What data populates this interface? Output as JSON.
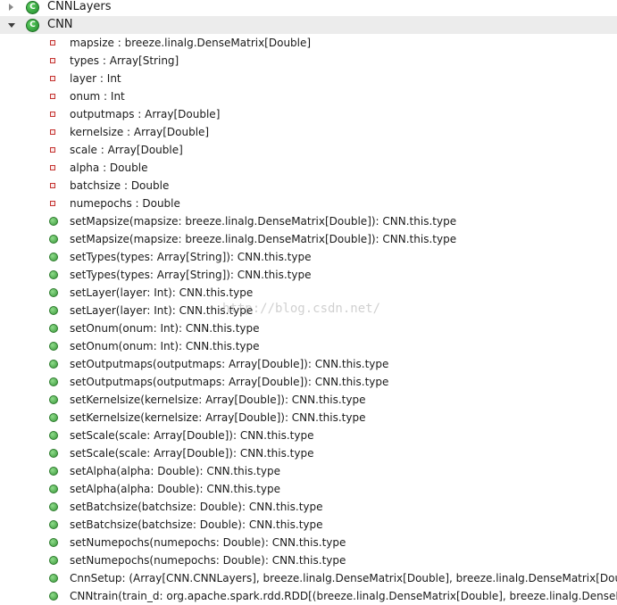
{
  "tree": {
    "nodes": [
      {
        "label": "CNNLayers",
        "kind": "class",
        "expanded": false,
        "depth": 0
      },
      {
        "label": "CNN",
        "kind": "class",
        "expanded": true,
        "depth": 0
      },
      {
        "label": "mapsize : breeze.linalg.DenseMatrix[Double]",
        "kind": "field",
        "depth": 1
      },
      {
        "label": "types : Array[String]",
        "kind": "field",
        "depth": 1
      },
      {
        "label": "layer : Int",
        "kind": "field",
        "depth": 1
      },
      {
        "label": "onum : Int",
        "kind": "field",
        "depth": 1
      },
      {
        "label": "outputmaps : Array[Double]",
        "kind": "field",
        "depth": 1
      },
      {
        "label": "kernelsize : Array[Double]",
        "kind": "field",
        "depth": 1
      },
      {
        "label": "scale : Array[Double]",
        "kind": "field",
        "depth": 1
      },
      {
        "label": "alpha : Double",
        "kind": "field",
        "depth": 1
      },
      {
        "label": "batchsize : Double",
        "kind": "field",
        "depth": 1
      },
      {
        "label": "numepochs : Double",
        "kind": "field",
        "depth": 1
      },
      {
        "label": "setMapsize(mapsize: breeze.linalg.DenseMatrix[Double]): CNN.this.type",
        "kind": "method",
        "depth": 1
      },
      {
        "label": "setMapsize(mapsize: breeze.linalg.DenseMatrix[Double]): CNN.this.type",
        "kind": "method",
        "depth": 1
      },
      {
        "label": "setTypes(types: Array[String]): CNN.this.type",
        "kind": "method",
        "depth": 1
      },
      {
        "label": "setTypes(types: Array[String]): CNN.this.type",
        "kind": "method",
        "depth": 1
      },
      {
        "label": "setLayer(layer: Int): CNN.this.type",
        "kind": "method",
        "depth": 1
      },
      {
        "label": "setLayer(layer: Int): CNN.this.type",
        "kind": "method",
        "depth": 1
      },
      {
        "label": "setOnum(onum: Int): CNN.this.type",
        "kind": "method",
        "depth": 1
      },
      {
        "label": "setOnum(onum: Int): CNN.this.type",
        "kind": "method",
        "depth": 1
      },
      {
        "label": "setOutputmaps(outputmaps: Array[Double]): CNN.this.type",
        "kind": "method",
        "depth": 1
      },
      {
        "label": "setOutputmaps(outputmaps: Array[Double]): CNN.this.type",
        "kind": "method",
        "depth": 1
      },
      {
        "label": "setKernelsize(kernelsize: Array[Double]): CNN.this.type",
        "kind": "method",
        "depth": 1
      },
      {
        "label": "setKernelsize(kernelsize: Array[Double]): CNN.this.type",
        "kind": "method",
        "depth": 1
      },
      {
        "label": "setScale(scale: Array[Double]): CNN.this.type",
        "kind": "method",
        "depth": 1
      },
      {
        "label": "setScale(scale: Array[Double]): CNN.this.type",
        "kind": "method",
        "depth": 1
      },
      {
        "label": "setAlpha(alpha: Double): CNN.this.type",
        "kind": "method",
        "depth": 1
      },
      {
        "label": "setAlpha(alpha: Double): CNN.this.type",
        "kind": "method",
        "depth": 1
      },
      {
        "label": "setBatchsize(batchsize: Double): CNN.this.type",
        "kind": "method",
        "depth": 1
      },
      {
        "label": "setBatchsize(batchsize: Double): CNN.this.type",
        "kind": "method",
        "depth": 1
      },
      {
        "label": "setNumepochs(numepochs: Double): CNN.this.type",
        "kind": "method",
        "depth": 1
      },
      {
        "label": "setNumepochs(numepochs: Double): CNN.this.type",
        "kind": "method",
        "depth": 1
      },
      {
        "label": "CnnSetup: (Array[CNN.CNNLayers], breeze.linalg.DenseMatrix[Double], breeze.linalg.DenseMatrix[Double]",
        "kind": "method",
        "depth": 1
      },
      {
        "label": "CNNtrain(train_d: org.apache.spark.rdd.RDD[(breeze.linalg.DenseMatrix[Double], breeze.linalg.DenseMat",
        "kind": "method",
        "depth": 1
      }
    ],
    "class_icon_letter": "C"
  },
  "watermark": "http://blog.csdn.net/",
  "icons": {
    "class": "class-icon",
    "field": "private-field-icon",
    "method": "public-method-icon",
    "collapsed": "expand-arrow-icon",
    "expanded": "collapse-arrow-icon"
  },
  "colors": {
    "class_icon": "#2e9a36",
    "field_icon": "#c4322f",
    "method_icon": "#4aa84a",
    "selected_row": "#ececec"
  }
}
